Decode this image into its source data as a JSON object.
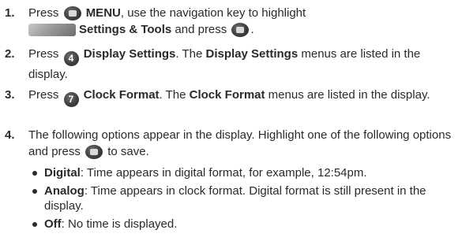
{
  "steps": [
    {
      "num": "1.",
      "line1_pre": "Press ",
      "line1_bold": "MENU",
      "line1_post": ", use the navigation key to highlight",
      "line2_bold": "Settings & Tools",
      "line2_post": " and press "
    },
    {
      "num": "2.",
      "pre": "Press ",
      "bold1": "Display Settings",
      "mid": ". The ",
      "bold2": "Display Settings",
      "post": " menus are listed in the display."
    },
    {
      "num": "3.",
      "pre": "Press ",
      "bold1": "Clock Format",
      "mid": ". The ",
      "bold2": "Clock Format",
      "post": " menus are listed in the display."
    },
    {
      "num": "4.",
      "text_pre": "The following options appear in the display. Highlight one of the following options and press ",
      "text_post": " to save."
    }
  ],
  "options": [
    {
      "name": "Digital",
      "desc": ": Time appears in digital format, for example, 12:54pm."
    },
    {
      "name": "Analog",
      "desc": ": Time appears in clock format. Digital format is still present in the display."
    },
    {
      "name": "Off",
      "desc": ": No time is displayed."
    }
  ],
  "icons": {
    "ok_key": "ok-key-icon",
    "settings_folder": "settings-tools-icon",
    "key_4": "4",
    "key_7": "7"
  }
}
